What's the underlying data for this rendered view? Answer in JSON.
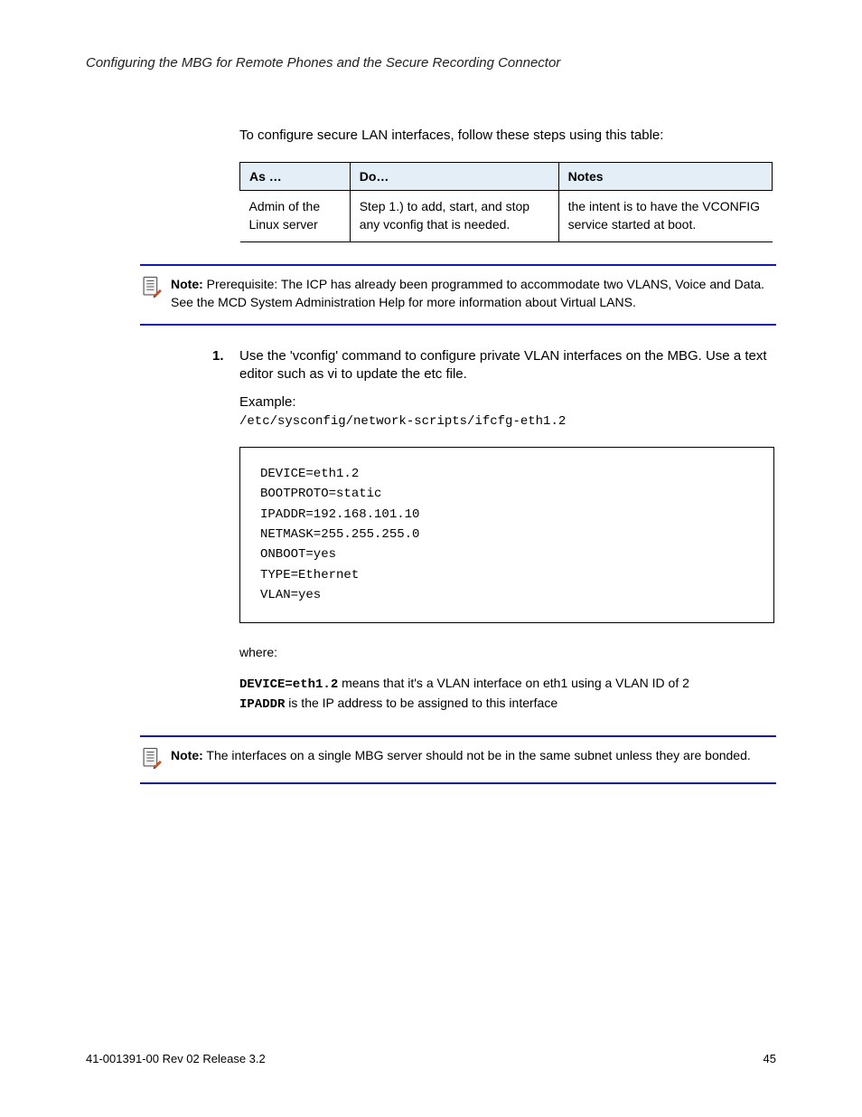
{
  "header": "Configuring the MBG for Remote Phones and the Secure Recording Connector",
  "intro": "To configure secure LAN interfaces, follow these steps using this table:",
  "table": {
    "headers": [
      "As …",
      "Do…",
      "Notes"
    ],
    "rows": [
      [
        "Admin of the Linux server",
        "Step 1.) to add, start, and stop any vconfig that is needed.",
        "the intent is to have the VCONFIG service started at boot."
      ]
    ]
  },
  "note1": {
    "label": "Note:",
    "text": " Prerequisite: The ICP has already been programmed to accommodate two VLANS, Voice and Data. See the MCD System Administration Help for more information about Virtual LANS."
  },
  "step1": {
    "num": "1.",
    "text": "Use the 'vconfig' command to configure private VLAN interfaces on the MBG. Use a text editor such as vi to update the etc file."
  },
  "example_label": "Example:",
  "example_path": "/etc/sysconfig/network-scripts/ifcfg-eth1.2",
  "snippet": "DEVICE=eth1.2\nBOOTPROTO=static\nIPADDR=192.168.101.10\nNETMASK=255.255.255.0\nONBOOT=yes\nTYPE=Ethernet\nVLAN=yes",
  "where_intro": "where:",
  "where_items": [
    {
      "bold": "DEVICE=eth1.2",
      "text": " means that it's a VLAN interface on eth1 using a VLAN ID of 2"
    },
    {
      "bold": "IPADDR",
      "text": " is the IP address to be assigned to this interface"
    }
  ],
  "note2": {
    "label": "Note:",
    "text": " The interfaces on a single MBG server should not be in the same subnet unless they are bonded."
  },
  "footer": {
    "left": "41-001391-00 Rev 02 Release 3.2",
    "right": "45"
  }
}
